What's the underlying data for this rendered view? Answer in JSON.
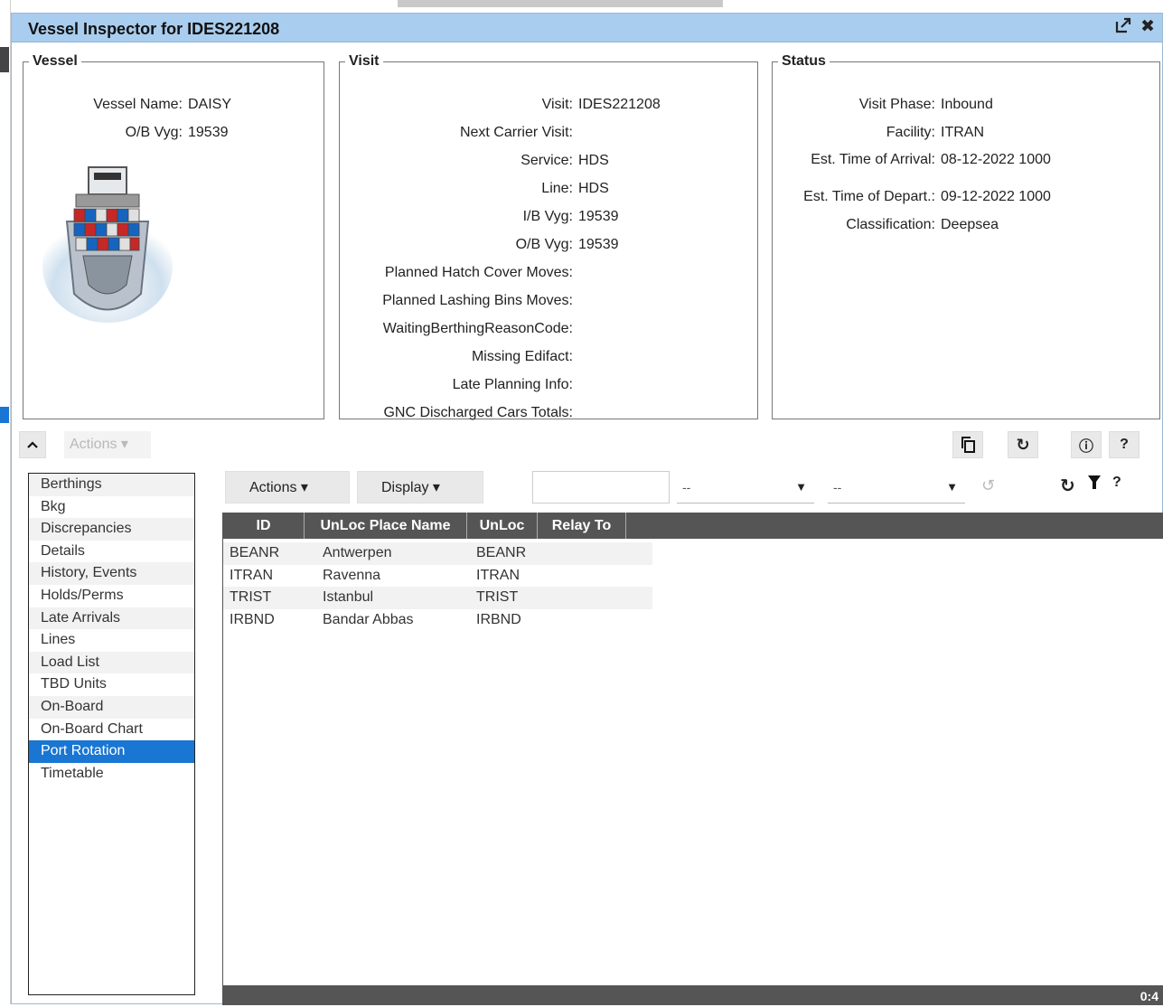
{
  "window": {
    "title": "Vessel Inspector for IDES221208"
  },
  "vessel": {
    "legend": "Vessel",
    "fields": [
      {
        "label": "Vessel Name:",
        "value": "DAISY"
      },
      {
        "label": "O/B Vyg:",
        "value": "19539"
      }
    ]
  },
  "visit": {
    "legend": "Visit",
    "fields": [
      {
        "label": "Visit:",
        "value": "IDES221208"
      },
      {
        "label": "Next Carrier Visit:",
        "value": ""
      },
      {
        "label": "Service:",
        "value": "HDS"
      },
      {
        "label": "Line:",
        "value": "HDS"
      },
      {
        "label": "I/B Vyg:",
        "value": "19539"
      },
      {
        "label": "O/B Vyg:",
        "value": "19539"
      },
      {
        "label": "Planned Hatch Cover Moves:",
        "value": ""
      },
      {
        "label": "Planned Lashing Bins Moves:",
        "value": ""
      },
      {
        "label": "WaitingBerthingReasonCode:",
        "value": ""
      },
      {
        "label": "Missing Edifact:",
        "value": ""
      },
      {
        "label": "Late Planning Info:",
        "value": ""
      },
      {
        "label": "GNC Discharged Cars Totals:",
        "value": ""
      }
    ]
  },
  "status": {
    "legend": "Status",
    "fields": [
      {
        "label": "Visit Phase:",
        "value": "Inbound"
      },
      {
        "label": "Facility:",
        "value": "ITRAN"
      },
      {
        "label": "Est. Time of Arrival:",
        "value": "08-12-2022 1000"
      },
      {
        "label": "Est. Time of Depart.:",
        "value": "09-12-2022 1000"
      },
      {
        "label": "Classification:",
        "value": "Deepsea"
      }
    ]
  },
  "upper_toolbar": {
    "actions_label": "Actions"
  },
  "tabs": [
    "Berthings",
    "Bkg",
    "Discrepancies",
    "Details",
    "History, Events",
    "Holds/Perms",
    "Late Arrivals",
    "Lines",
    "Load List",
    "TBD Units",
    "On-Board",
    "On-Board Chart",
    "Port Rotation",
    "Timetable"
  ],
  "active_tab": "Port Rotation",
  "grid_toolbar": {
    "actions_label": "Actions",
    "display_label": "Display",
    "search_placeholder": "",
    "filter1_value": "--",
    "filter2_value": "--"
  },
  "grid": {
    "columns": [
      "ID",
      "UnLoc Place Name",
      "UnLoc",
      "Relay To"
    ],
    "rows": [
      [
        "BEANR",
        "Antwerpen",
        "BEANR",
        ""
      ],
      [
        "ITRAN",
        "Ravenna",
        "ITRAN",
        ""
      ],
      [
        "TRIST",
        "Istanbul",
        "TRIST",
        ""
      ],
      [
        "IRBND",
        "Bandar Abbas",
        "IRBND",
        ""
      ]
    ],
    "footer_count": "0:4"
  },
  "colors": {
    "titlebar": "#a9cdee",
    "active_tab": "#1976d2",
    "grid_header": "#555555"
  }
}
